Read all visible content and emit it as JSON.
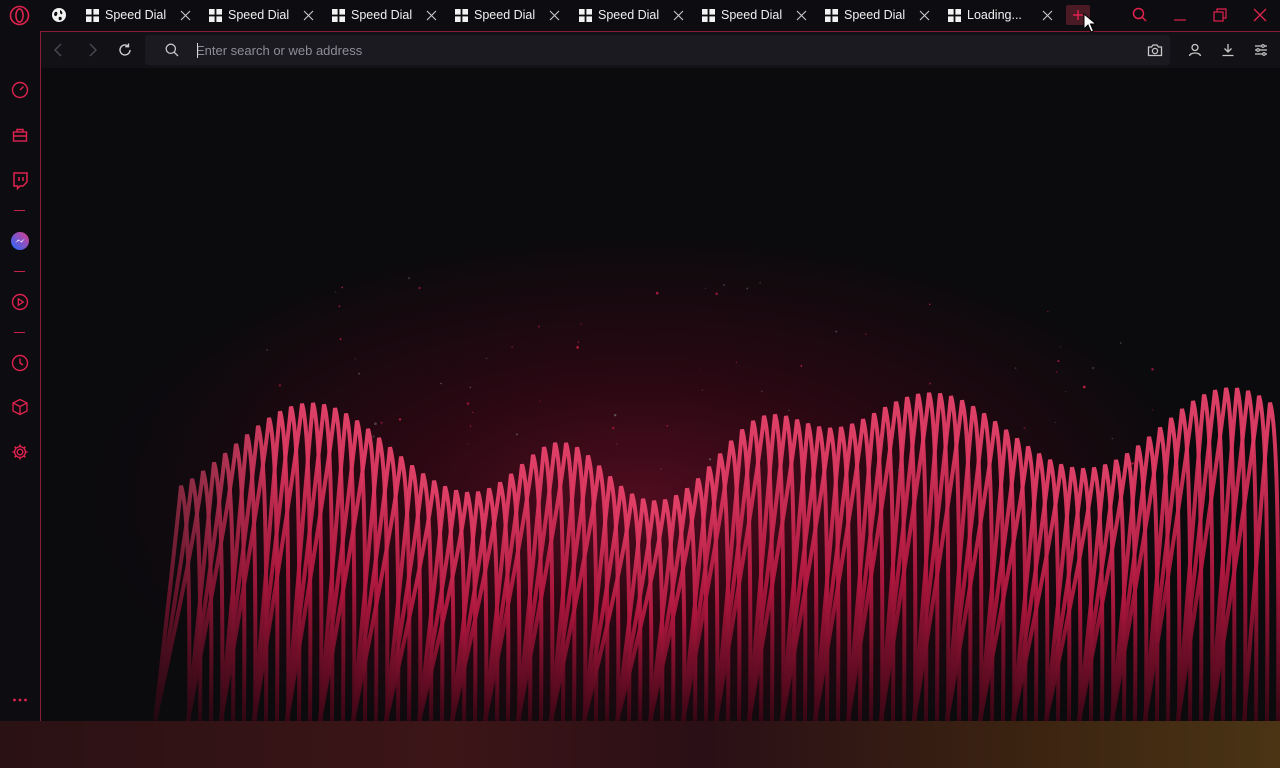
{
  "browser": {
    "tabs": [
      {
        "title": "Speed Dial",
        "kind": "speed-dial"
      },
      {
        "title": "Speed Dial",
        "kind": "speed-dial"
      },
      {
        "title": "Speed Dial",
        "kind": "speed-dial"
      },
      {
        "title": "Speed Dial",
        "kind": "speed-dial"
      },
      {
        "title": "Speed Dial",
        "kind": "speed-dial"
      },
      {
        "title": "Speed Dial",
        "kind": "speed-dial"
      },
      {
        "title": "Speed Dial",
        "kind": "speed-dial"
      },
      {
        "title": "Loading...",
        "kind": "speed-dial"
      }
    ],
    "address_bar": {
      "value": "",
      "placeholder": "Enter search or web address"
    },
    "sidebar": {
      "items": [
        {
          "icon": "speedometer-icon"
        },
        {
          "icon": "bag-icon"
        },
        {
          "icon": "twitch-icon"
        },
        {
          "icon": "messenger-icon"
        },
        {
          "icon": "player-icon"
        },
        {
          "icon": "history-icon"
        },
        {
          "icon": "cube-icon"
        },
        {
          "icon": "gear-icon"
        }
      ],
      "more_icon": "more-icon"
    },
    "colors": {
      "accent": "#e0224f",
      "background": "#0b0a0d",
      "tabbar": "#0d0c10"
    }
  }
}
